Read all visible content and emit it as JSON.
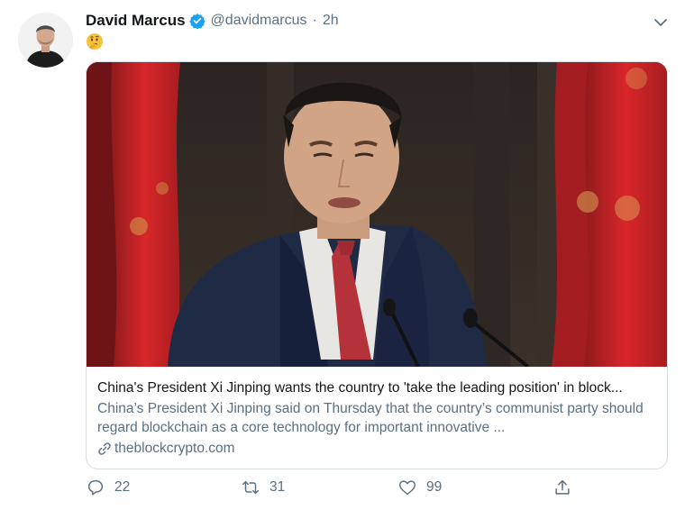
{
  "tweet": {
    "author_name": "David Marcus",
    "handle": "@davidmarcus",
    "separator": "·",
    "time": "2h",
    "emoji": "🤔"
  },
  "card": {
    "title": "China's President Xi Jinping wants the country to 'take the leading position' in block...",
    "description": "China’s President Xi Jinping said on Thursday that the country’s communist party should regard blockchain as a core technology for important innovative ...",
    "domain": "theblockcrypto.com"
  },
  "actions": {
    "replies": "22",
    "retweets": "31",
    "likes": "99"
  },
  "colors": {
    "verified_blue": "#1da1f2",
    "secondary_text": "#5b7083",
    "flag_red": "#d8262a"
  }
}
